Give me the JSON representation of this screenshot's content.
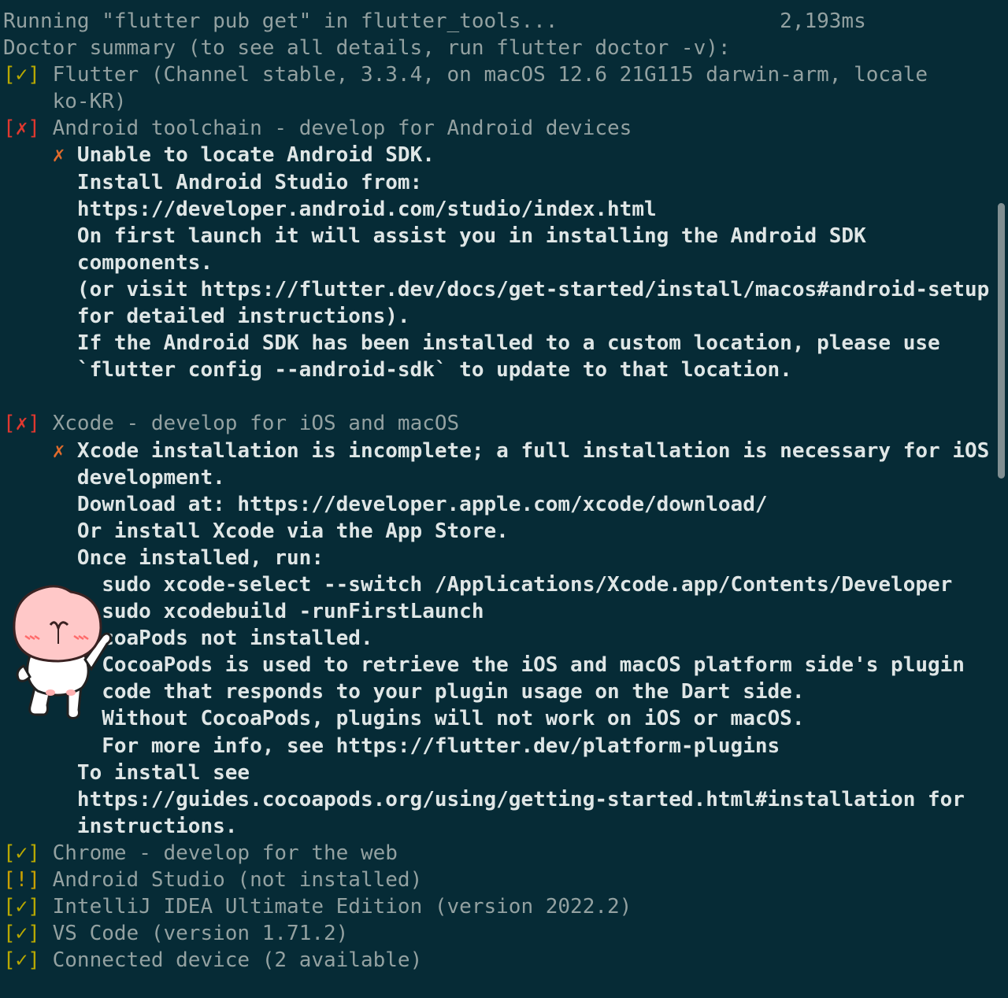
{
  "terminal": {
    "lines": [
      {
        "k": "plain",
        "text": "Running \"flutter pub get\" in flutter_tools...                  2,193ms"
      },
      {
        "k": "plain",
        "text": "Doctor summary (to see all details, run flutter doctor -v):"
      },
      {
        "k": "status",
        "status": "ok",
        "mark": "[✓]",
        "text": " Flutter (Channel stable, 3.3.4, on macOS 12.6 21G115 darwin-arm, locale"
      },
      {
        "k": "plain",
        "text": "    ko-KR)"
      },
      {
        "k": "status",
        "status": "err",
        "mark": "[✗]",
        "text": " Android toolchain - develop for Android devices"
      },
      {
        "k": "cross",
        "indent": "    ",
        "mark": "✗",
        "text": " Unable to locate Android SDK."
      },
      {
        "k": "bold",
        "text": "      Install Android Studio from:"
      },
      {
        "k": "bold",
        "text": "      https://developer.android.com/studio/index.html"
      },
      {
        "k": "bold",
        "text": "      On first launch it will assist you in installing the Android SDK"
      },
      {
        "k": "bold",
        "text": "      components."
      },
      {
        "k": "bold",
        "text": "      (or visit https://flutter.dev/docs/get-started/install/macos#android-setup"
      },
      {
        "k": "bold",
        "text": "      for detailed instructions)."
      },
      {
        "k": "bold",
        "text": "      If the Android SDK has been installed to a custom location, please use"
      },
      {
        "k": "bold",
        "text": "      `flutter config --android-sdk` to update to that location."
      },
      {
        "k": "plain",
        "text": ""
      },
      {
        "k": "status",
        "status": "err",
        "mark": "[✗]",
        "text": " Xcode - develop for iOS and macOS"
      },
      {
        "k": "cross",
        "indent": "    ",
        "mark": "✗",
        "text": " Xcode installation is incomplete; a full installation is necessary for iOS"
      },
      {
        "k": "bold",
        "text": "      development."
      },
      {
        "k": "bold",
        "text": "      Download at: https://developer.apple.com/xcode/download/"
      },
      {
        "k": "bold",
        "text": "      Or install Xcode via the App Store."
      },
      {
        "k": "bold",
        "text": "      Once installed, run:"
      },
      {
        "k": "bold",
        "text": "        sudo xcode-select --switch /Applications/Xcode.app/Contents/Developer"
      },
      {
        "k": "bold",
        "text": "        sudo xcodebuild -runFirstLaunch"
      },
      {
        "k": "bold",
        "text": "        coaPods not installed."
      },
      {
        "k": "bold",
        "text": "        CocoaPods is used to retrieve the iOS and macOS platform side's plugin"
      },
      {
        "k": "bold",
        "text": "        code that responds to your plugin usage on the Dart side."
      },
      {
        "k": "bold",
        "text": "        Without CocoaPods, plugins will not work on iOS or macOS."
      },
      {
        "k": "bold",
        "text": "        For more info, see https://flutter.dev/platform-plugins"
      },
      {
        "k": "bold",
        "text": "      To install see"
      },
      {
        "k": "bold",
        "text": "      https://guides.cocoapods.org/using/getting-started.html#installation for"
      },
      {
        "k": "bold",
        "text": "      instructions."
      },
      {
        "k": "status",
        "status": "ok",
        "mark": "[✓]",
        "text": " Chrome - develop for the web"
      },
      {
        "k": "status",
        "status": "warn",
        "mark": "[!]",
        "text": " Android Studio (not installed)"
      },
      {
        "k": "status",
        "status": "ok",
        "mark": "[✓]",
        "text": " IntelliJ IDEA Ultimate Edition (version 2022.2)"
      },
      {
        "k": "status",
        "status": "ok",
        "mark": "[✓]",
        "text": " VS Code (version 1.71.2)"
      },
      {
        "k": "status",
        "status": "ok",
        "mark": "[✓]",
        "text": " Connected device (2 available)"
      }
    ]
  },
  "colors": {
    "background": "#062b36",
    "text": "#93a1a1",
    "bold_text": "#dfe6e6",
    "ok": "#b8a800",
    "error": "#e0382f",
    "warn": "#c9a000",
    "cross": "#e06b2c"
  },
  "sticker": {
    "icon": "peach-character-sticker"
  }
}
